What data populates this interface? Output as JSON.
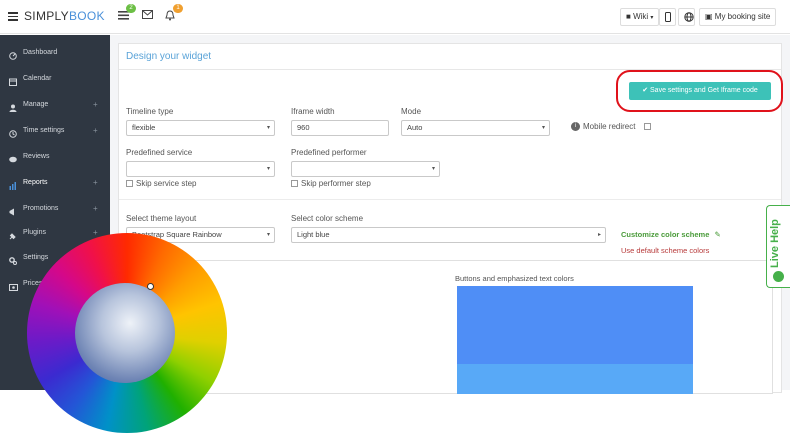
{
  "brand": {
    "part1": "SIMPLY",
    "part2": "BOOK"
  },
  "topbar": {
    "badges": {
      "list": "2",
      "bell": "1"
    },
    "wiki_label": "Wiki",
    "booking_site_label": "My booking site"
  },
  "sidebar": {
    "items": [
      {
        "label": "Dashboard",
        "icon": "dashboard-icon",
        "plus": ""
      },
      {
        "label": "Calendar",
        "icon": "calendar-icon",
        "plus": ""
      },
      {
        "label": "Manage",
        "icon": "user-icon",
        "plus": "+"
      },
      {
        "label": "Time settings",
        "icon": "clock-icon",
        "plus": "+"
      },
      {
        "label": "Reviews",
        "icon": "comments-icon",
        "plus": ""
      },
      {
        "label": "Reports",
        "icon": "bar-chart-icon",
        "plus": "+"
      },
      {
        "label": "Promotions",
        "icon": "megaphone-icon",
        "plus": "+"
      },
      {
        "label": "Plugins",
        "icon": "plug-icon",
        "plus": "+"
      },
      {
        "label": "Settings",
        "icon": "cogs-icon",
        "plus": ""
      },
      {
        "label": "Prices",
        "icon": "money-icon",
        "plus": "+"
      }
    ]
  },
  "main": {
    "title": "Design your widget",
    "save_button": "Save settings and Get Iframe code",
    "timeline_type": {
      "label": "Timeline type",
      "value": "flexible"
    },
    "iframe_width": {
      "label": "Iframe width",
      "value": "960"
    },
    "mode": {
      "label": "Mode",
      "value": "Auto"
    },
    "mobile_redirect": {
      "label": "Mobile redirect"
    },
    "predefined_service": {
      "label": "Predefined service",
      "value": ""
    },
    "predefined_performer": {
      "label": "Predefined performer",
      "value": ""
    },
    "skip_service": "Skip service step",
    "skip_performer": "Skip performer step",
    "theme_layout": {
      "label": "Select theme layout",
      "value": "Bootstrap Square Rainbow"
    },
    "color_scheme": {
      "label": "Select color scheme",
      "value": "Light blue"
    },
    "customize_link": "Customize color scheme",
    "default_link": "Use default scheme colors",
    "buttons_colors_label": "Buttons and emphasized text colors"
  },
  "live_help": "Live Help",
  "colors": {
    "accent": "#3dc2b8",
    "sidebar": "#2f3742",
    "title_blue": "#5aa3d8",
    "highlight_oval": "#e0121b",
    "live_help_green": "#46b04a",
    "swatch_blue": "#4f8ef6"
  }
}
